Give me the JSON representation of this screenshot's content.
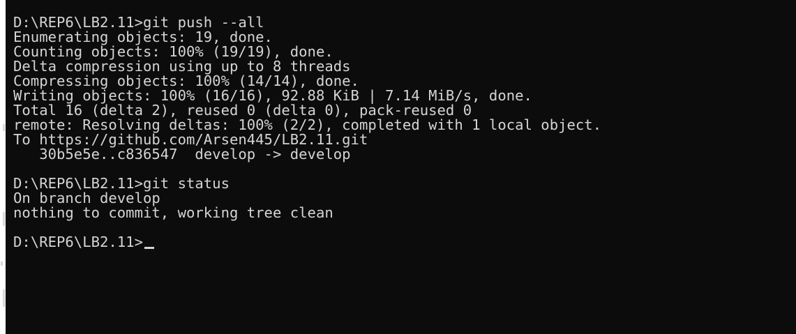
{
  "terminal": {
    "lines": [
      {
        "text": "D:\\REP6\\LB2.11>git push --all"
      },
      {
        "text": "Enumerating objects: 19, done."
      },
      {
        "text": "Counting objects: 100% (19/19), done."
      },
      {
        "text": "Delta compression using up to 8 threads"
      },
      {
        "text": "Compressing objects: 100% (14/14), done."
      },
      {
        "text": "Writing objects: 100% (16/16), 92.88 KiB | 7.14 MiB/s, done."
      },
      {
        "text": "Total 16 (delta 2), reused 0 (delta 0), pack-reused 0"
      },
      {
        "text": "remote: Resolving deltas: 100% (2/2), completed with 1 local object."
      },
      {
        "text": "To https://github.com/Arsen445/LB2.11.git"
      },
      {
        "text": "   30b5e5e..c836547  develop -> develop"
      },
      {
        "text": ""
      },
      {
        "text": "D:\\REP6\\LB2.11>git status"
      },
      {
        "text": "On branch develop"
      },
      {
        "text": "nothing to commit, working tree clean"
      },
      {
        "text": ""
      },
      {
        "text": "D:\\REP6\\LB2.11>"
      }
    ]
  },
  "colors": {
    "background": "#0c0c0c",
    "foreground": "#d4d4d4"
  }
}
